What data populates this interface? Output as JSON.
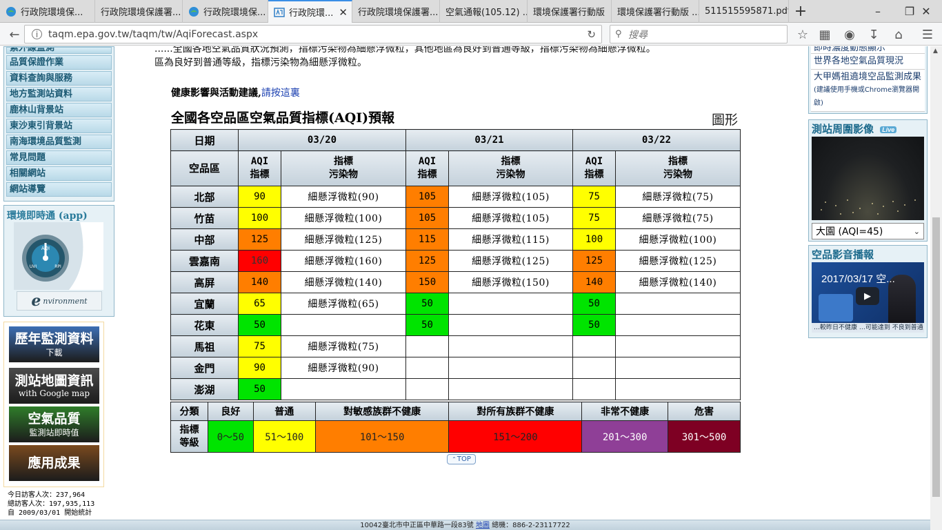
{
  "browser": {
    "tabs": [
      {
        "label": "行政院環境保...",
        "icon": "epa-globe-icon"
      },
      {
        "label": "行政院環境保護署...",
        "icon": ""
      },
      {
        "label": "行政院環境保...",
        "icon": "epa-globe-icon"
      },
      {
        "label": "行政院環...",
        "icon": "epa-logo-icon",
        "active": true
      },
      {
        "label": "行政院環境保護署...",
        "icon": ""
      },
      {
        "label": "空氣通報(105.12) ...",
        "icon": ""
      },
      {
        "label": "環境保護署行動版",
        "icon": ""
      },
      {
        "label": "環境保護署行動版 ...",
        "icon": ""
      },
      {
        "label": "511515595871.pdf",
        "icon": ""
      }
    ],
    "url": "taqm.epa.gov.tw/taqm/tw/AqiForecast.aspx",
    "search_placeholder": "搜尋"
  },
  "left_menu": {
    "items": [
      "紫外線監測",
      "品質保證作業",
      "資料查詢與服務",
      "地方監測站資料",
      "鹿林山背景站",
      "東沙東引背景站",
      "南海環境品質監測",
      "常見問題",
      "相關網站",
      "網站導覽"
    ]
  },
  "app_box": {
    "title": "環境即時通 (app)",
    "gauge_center": "AQI",
    "gauge_left": "UVI",
    "gauge_right": "RPI"
  },
  "banners": [
    {
      "line1": "歷年監測資料",
      "line2": "下載",
      "color": "#3d6fb4"
    },
    {
      "line1": "測站地圖資訊",
      "line2": "with Google map",
      "color": "#4b4b4b"
    },
    {
      "line1": "空氣品質",
      "line2": "監測站即時值",
      "color": "#2f7d2a"
    },
    {
      "line1": "應用成果",
      "line2": "",
      "color": "#7a4a1e"
    }
  ],
  "visitors": {
    "today": "今日訪客人次：237,964",
    "total": "總訪客人次：197,935,113",
    "since": "自 2009/03/01 開始統計"
  },
  "intro_text": "......全國各地空氣品質狀況預測，指標污染物為細懸浮微粒，其他地區為良好到普通等級，指標污染物為細懸浮微粒。",
  "intro_line2": "區為良好到普通等級，指標污染物為細懸浮微粒。",
  "health": {
    "label": "健康影響與活動建議,",
    "link": "請按這裏"
  },
  "table": {
    "title": "全國各空品區空氣品質指標(AQI)預報",
    "graph_link": "圖形",
    "date_label": "日期",
    "region_label": "空品區",
    "aqi_label_1": "AQI",
    "aqi_label_2": "指標",
    "pol_label_1": "指標",
    "pol_label_2": "污染物",
    "dates": [
      "03/20",
      "03/21",
      "03/22"
    ],
    "rows": [
      {
        "region": "北部",
        "cells": [
          {
            "v": "90",
            "c": "#ffff00",
            "p": "細懸浮微粒(90)"
          },
          {
            "v": "105",
            "c": "#ff7e00",
            "p": "細懸浮微粒(105)"
          },
          {
            "v": "75",
            "c": "#ffff00",
            "p": "細懸浮微粒(75)"
          }
        ]
      },
      {
        "region": "竹苗",
        "cells": [
          {
            "v": "100",
            "c": "#ffff00",
            "p": "細懸浮微粒(100)"
          },
          {
            "v": "105",
            "c": "#ff7e00",
            "p": "細懸浮微粒(105)"
          },
          {
            "v": "75",
            "c": "#ffff00",
            "p": "細懸浮微粒(75)"
          }
        ]
      },
      {
        "region": "中部",
        "cells": [
          {
            "v": "125",
            "c": "#ff7e00",
            "p": "細懸浮微粒(125)"
          },
          {
            "v": "115",
            "c": "#ff7e00",
            "p": "細懸浮微粒(115)"
          },
          {
            "v": "100",
            "c": "#ffff00",
            "p": "細懸浮微粒(100)"
          }
        ]
      },
      {
        "region": "雲嘉南",
        "cells": [
          {
            "v": "160",
            "c": "#ff0000",
            "p": "細懸浮微粒(160)"
          },
          {
            "v": "125",
            "c": "#ff7e00",
            "p": "細懸浮微粒(125)"
          },
          {
            "v": "125",
            "c": "#ff7e00",
            "p": "細懸浮微粒(125)"
          }
        ]
      },
      {
        "region": "高屏",
        "cells": [
          {
            "v": "140",
            "c": "#ff7e00",
            "p": "細懸浮微粒(140)"
          },
          {
            "v": "150",
            "c": "#ff7e00",
            "p": "細懸浮微粒(150)"
          },
          {
            "v": "140",
            "c": "#ff7e00",
            "p": "細懸浮微粒(140)"
          }
        ]
      },
      {
        "region": "宜蘭",
        "cells": [
          {
            "v": "65",
            "c": "#ffff00",
            "p": "細懸浮微粒(65)"
          },
          {
            "v": "50",
            "c": "#00e400",
            "p": ""
          },
          {
            "v": "50",
            "c": "#00e400",
            "p": ""
          }
        ]
      },
      {
        "region": "花東",
        "cells": [
          {
            "v": "50",
            "c": "#00e400",
            "p": ""
          },
          {
            "v": "50",
            "c": "#00e400",
            "p": ""
          },
          {
            "v": "50",
            "c": "#00e400",
            "p": ""
          }
        ]
      },
      {
        "region": "馬祖",
        "cells": [
          {
            "v": "75",
            "c": "#ffff00",
            "p": "細懸浮微粒(75)"
          },
          {
            "v": "",
            "c": "",
            "p": ""
          },
          {
            "v": "",
            "c": "",
            "p": ""
          }
        ]
      },
      {
        "region": "金門",
        "cells": [
          {
            "v": "90",
            "c": "#ffff00",
            "p": "細懸浮微粒(90)"
          },
          {
            "v": "",
            "c": "",
            "p": ""
          },
          {
            "v": "",
            "c": "",
            "p": ""
          }
        ]
      },
      {
        "region": "澎湖",
        "cells": [
          {
            "v": "50",
            "c": "#00e400",
            "p": ""
          },
          {
            "v": "",
            "c": "",
            "p": ""
          },
          {
            "v": "",
            "c": "",
            "p": ""
          }
        ]
      }
    ]
  },
  "legend": {
    "category_label": "分類",
    "index_label_1": "指標",
    "index_label_2": "等級",
    "levels": [
      {
        "name": "良好",
        "range": "0～50",
        "color": "#00e400",
        "text": "#222222"
      },
      {
        "name": "普通",
        "range": "51～100",
        "color": "#ffff00",
        "text": "#222222"
      },
      {
        "name": "對敏感族群不健康",
        "range": "101～150",
        "color": "#ff7e00",
        "text": "#222222"
      },
      {
        "name": "對所有族群不健康",
        "range": "151～200",
        "color": "#ff0000",
        "text": "#222222"
      },
      {
        "name": "非常不健康",
        "range": "201～300",
        "color": "#8f3f97",
        "text": "#ffffff"
      },
      {
        "name": "危害",
        "range": "301～500",
        "color": "#7e0023",
        "text": "#ffffff"
      }
    ]
  },
  "top_button": "TOP",
  "right_links": [
    {
      "text": "即時濃度動態顯示",
      "note": ""
    },
    {
      "text": "世界各地空氣品質現況",
      "note": ""
    },
    {
      "text": "大甲媽祖遶境空品監測成果",
      "note": "(建議使用手機或Chrome瀏覽器開啟)"
    }
  ],
  "camera": {
    "title": "測站周圍影像",
    "live": "Live",
    "selected": "大園 (AQI=45)"
  },
  "video": {
    "title": "空品影音播報",
    "clip_title": "2017/03/17 空...",
    "ticker": "…較昨日不健康 …可能達到 不良到普通"
  },
  "footer": {
    "address": "10042臺北市中正區中華路一段83號",
    "map_link": "地圖",
    "phone": "總機：886-2-23117722"
  }
}
